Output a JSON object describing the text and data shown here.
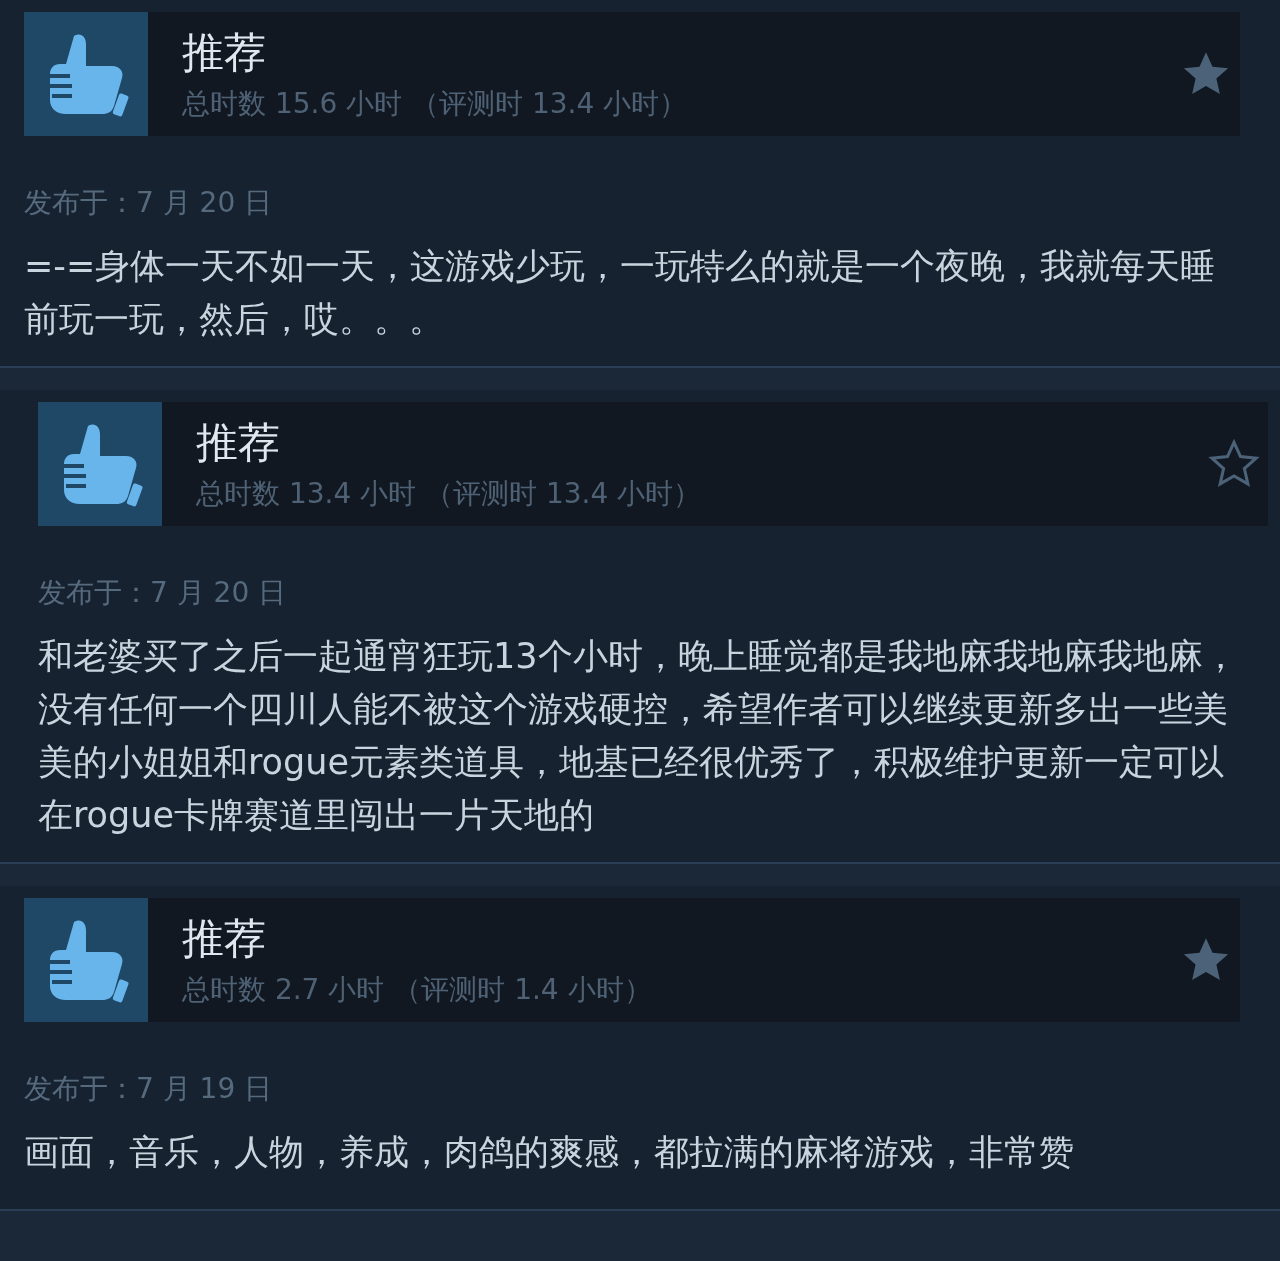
{
  "reviews": [
    {
      "verdict": "推荐",
      "hours": "总时数 15.6 小时 （评测时 13.4 小时）",
      "starred": true,
      "date": "发布于：7 月 20 日",
      "text": "=-=身体一天不如一天，这游戏少玩，一玩特么的就是一个夜晚，我就每天睡前玩一玩，然后，哎。。。"
    },
    {
      "verdict": "推荐",
      "hours": "总时数 13.4 小时 （评测时 13.4 小时）",
      "starred": false,
      "date": "发布于：7 月 20 日",
      "text": "和老婆买了之后一起通宵狂玩13个小时，晚上睡觉都是我地麻我地麻我地麻，没有任何一个四川人能不被这个游戏硬控，希望作者可以继续更新多出一些美美的小姐姐和rogue元素类道具，地基已经很优秀了，积极维护更新一定可以在rogue卡牌赛道里闯出一片天地的"
    },
    {
      "verdict": "推荐",
      "hours": "总时数 2.7 小时 （评测时 1.4 小时）",
      "starred": true,
      "date": "发布于：7 月 19 日",
      "text": "画面，音乐，人物，养成，肉鸽的爽感，都拉满的麻将游戏，非常赞"
    }
  ]
}
